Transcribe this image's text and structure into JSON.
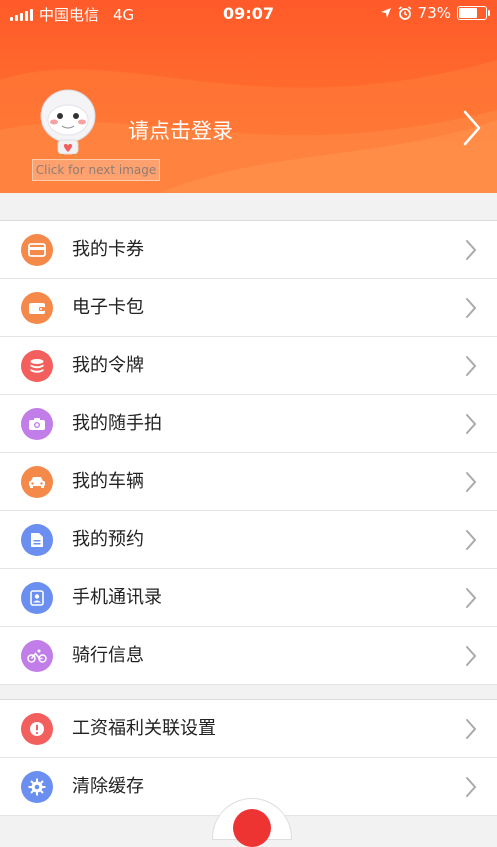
{
  "status_bar": {
    "carrier": "中国电信",
    "network": "4G",
    "time": "09:07",
    "battery_percent_label": "73%",
    "battery_level": 0.73
  },
  "header": {
    "login_text": "请点击登录",
    "tooltip_text": "Click for next image",
    "accent_color": "#ff6a2c"
  },
  "menu_group_1": [
    {
      "label": "我的卡券",
      "icon": "card-icon",
      "color": "#f5894a"
    },
    {
      "label": "电子卡包",
      "icon": "wallet-icon",
      "color": "#f5894a"
    },
    {
      "label": "我的令牌",
      "icon": "database-icon",
      "color": "#f25f5c"
    },
    {
      "label": "我的随手拍",
      "icon": "camera-icon",
      "color": "#c27ee8"
    },
    {
      "label": "我的车辆",
      "icon": "car-icon",
      "color": "#f5894a"
    },
    {
      "label": "我的预约",
      "icon": "document-icon",
      "color": "#6b8ff0"
    },
    {
      "label": "手机通讯录",
      "icon": "contacts-icon",
      "color": "#6b8ff0"
    },
    {
      "label": "骑行信息",
      "icon": "bicycle-icon",
      "color": "#c27ee8"
    }
  ],
  "menu_group_2": [
    {
      "label": "工资福利关联设置",
      "icon": "alert-icon",
      "color": "#f25f5c"
    },
    {
      "label": "清除缓存",
      "icon": "gear-icon",
      "color": "#6b8ff0"
    }
  ]
}
